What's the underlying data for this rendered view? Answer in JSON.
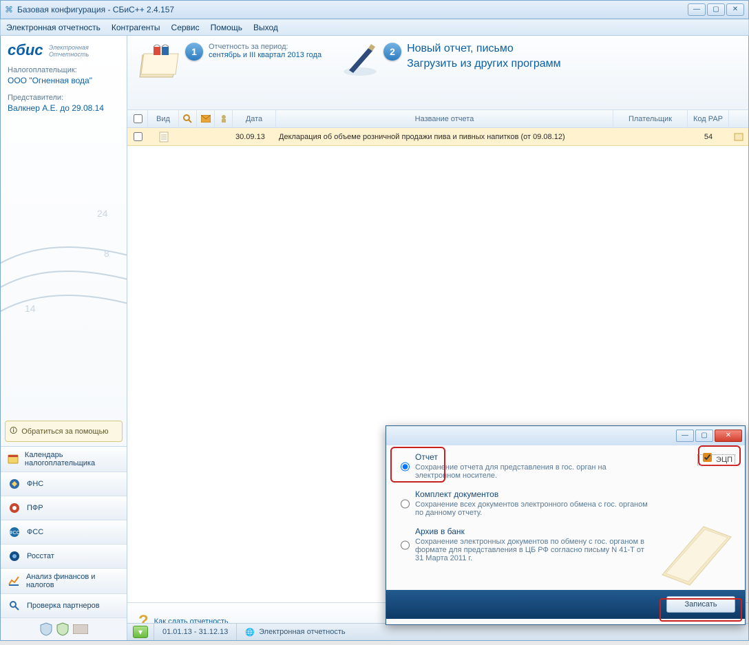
{
  "window": {
    "title": "Базовая конфигурация - СБиС++ 2.4.157"
  },
  "menu": [
    "Электронная отчетность",
    "Контрагенты",
    "Сервис",
    "Помощь",
    "Выход"
  ],
  "logo": {
    "main": "сбис",
    "sub1": "Электронная",
    "sub2": "Отчетность"
  },
  "taxpayer": {
    "label": "Налогоплательщик:",
    "name": "ООО \"Огненная вода\""
  },
  "rep": {
    "label": "Представители:",
    "name": "Валкнер А.Е. до 29.08.14"
  },
  "help_button": "Обратиться за помощью",
  "side_items": [
    {
      "label": "Календарь налогоплательщика"
    },
    {
      "label": "ФНС"
    },
    {
      "label": "ПФР"
    },
    {
      "label": "ФСС"
    },
    {
      "label": "Росстат"
    },
    {
      "label": "Анализ финансов и налогов"
    },
    {
      "label": "Проверка партнеров"
    }
  ],
  "header": {
    "step1_label": "Отчетность за период:",
    "step1_period": "сентябрь и III квартал 2013 года",
    "step2_new": "Новый отчет, письмо",
    "step2_load": "Загрузить из других программ"
  },
  "grid": {
    "cols": {
      "vid": "Вид",
      "date": "Дата",
      "name": "Название отчета",
      "payer": "Плательщик",
      "code": "Код РАР"
    },
    "row": {
      "date": "30.09.13",
      "name": "Декларация об объеме розничной продажи пива и пивных напитков (от 09.08.12)",
      "code": "54"
    }
  },
  "main_help": "Как сдать отчетность",
  "bottom": {
    "period": "01.01.13 - 31.12.13",
    "caption": "Электронная отчетность"
  },
  "dialog": {
    "opt1_label": "Отчет",
    "opt1_desc": "Сохранение отчета для представления в гос. орган на электронном носителе.",
    "opt2_label": "Комплект документов",
    "opt2_desc": "Сохранение всех документов электронного обмена с гос. органом по данному отчету.",
    "opt3_label": "Архив в банк",
    "opt3_desc": "Сохранение электронных документов по обмену с гос. органом в формате для представления в ЦБ РФ согласно письму N 41-Т от 31 Марта 2011 г.",
    "ecp": "ЭЦП",
    "save": "Записать"
  }
}
